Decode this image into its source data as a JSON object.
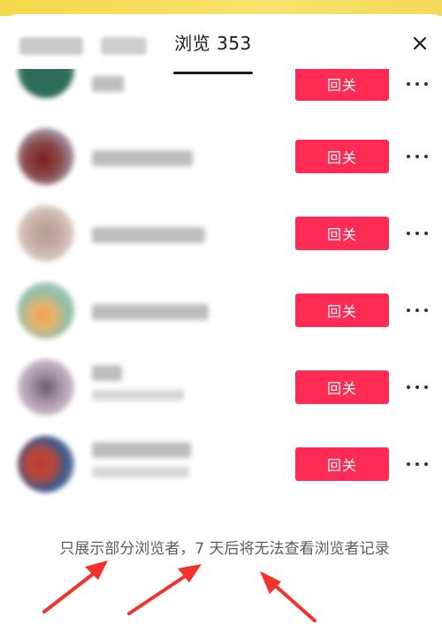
{
  "header": {
    "active_tab": "浏览 353",
    "close_icon": "close-icon"
  },
  "list": {
    "rows": [
      {
        "avatar_color": "#2f6b5a",
        "button_label": "回关"
      },
      {
        "avatar_color": "#8b4a4a",
        "button_label": "回关"
      },
      {
        "avatar_color": "#c9b2a8",
        "button_label": "回关"
      },
      {
        "avatar_color": "#8fbfa8",
        "button_label": "回关"
      },
      {
        "avatar_color": "#a996a8",
        "button_label": "回关"
      },
      {
        "avatar_color": "#b8483a",
        "button_label": "回关"
      }
    ],
    "more_icon": "more-dots-icon"
  },
  "footer": {
    "notice": "只展示部分浏览者，7 天后将无法查看浏览者记录"
  },
  "colors": {
    "accent": "#fe2c55",
    "annotation_arrow": "#f2332b",
    "top_strip": "#f6d84a"
  }
}
